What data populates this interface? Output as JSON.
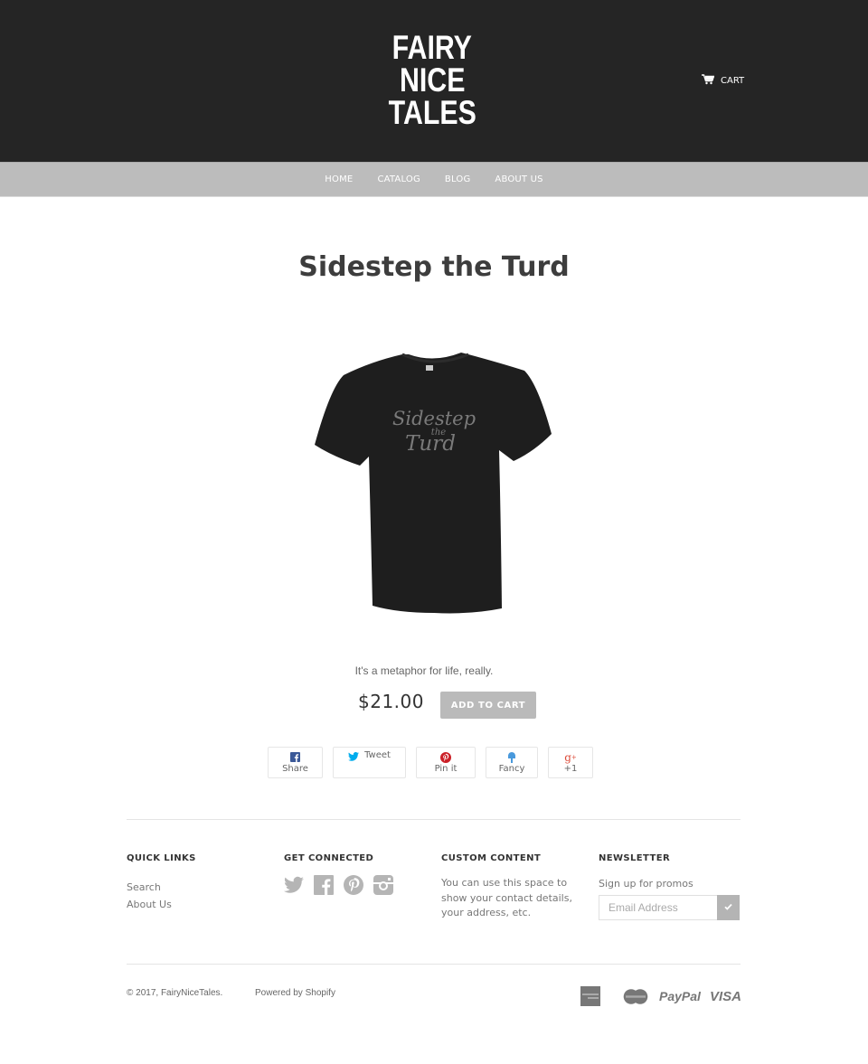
{
  "header": {
    "logo_lines": [
      "FAIRY",
      "NICE",
      "TALES"
    ],
    "cart_label": "CART",
    "cart_icon": "shopping-cart-icon"
  },
  "nav": {
    "items": [
      {
        "label": "HOME"
      },
      {
        "label": "CATALOG"
      },
      {
        "label": "BLOG"
      },
      {
        "label": "ABOUT US"
      }
    ]
  },
  "product": {
    "title": "Sidestep the Turd",
    "image_alt": "Black t-shirt printed with 'Sidestep the Turd'",
    "shirt_print_lines": [
      "Sidestep",
      "the",
      "Turd"
    ],
    "description": "It's a metaphor for life, really.",
    "price": "$21.00",
    "add_to_cart_label": "ADD TO CART"
  },
  "share": {
    "buttons": [
      {
        "label": "Share",
        "icon": "facebook-icon",
        "color": "#3b5998"
      },
      {
        "label": "Tweet",
        "icon": "twitter-icon",
        "color": "#00aced"
      },
      {
        "label": "Pin it",
        "icon": "pinterest-icon",
        "color": "#cb2027"
      },
      {
        "label": "Fancy",
        "icon": "fancy-icon",
        "color": "#4999dc"
      },
      {
        "label": "+1",
        "icon": "google-plus-icon",
        "color": "#dd4b39"
      }
    ]
  },
  "footer": {
    "quick_links": {
      "heading": "QUICK LINKS",
      "links": [
        {
          "label": "Search"
        },
        {
          "label": "About Us"
        }
      ]
    },
    "get_connected": {
      "heading": "GET CONNECTED",
      "icons": [
        "twitter-icon",
        "facebook-icon",
        "pinterest-icon",
        "instagram-icon"
      ]
    },
    "custom_content": {
      "heading": "CUSTOM CONTENT",
      "text": "You can use this space to show your contact details, your address, etc."
    },
    "newsletter": {
      "heading": "NEWSLETTER",
      "subtext": "Sign up for promos",
      "email_placeholder": "Email Address",
      "email_value": "",
      "submit_icon": "checkmark-icon"
    },
    "copyright": "© 2017, FairyNiceTales.",
    "powered_by": "Powered by Shopify",
    "payment_methods": [
      {
        "name": "American Express",
        "icon": "amex-icon"
      },
      {
        "name": "MasterCard",
        "icon": "mastercard-icon",
        "label": "MasterCard"
      },
      {
        "name": "PayPal",
        "icon": "paypal-icon",
        "label": "PayPal"
      },
      {
        "name": "Visa",
        "icon": "visa-icon",
        "label": "VISA"
      }
    ]
  }
}
